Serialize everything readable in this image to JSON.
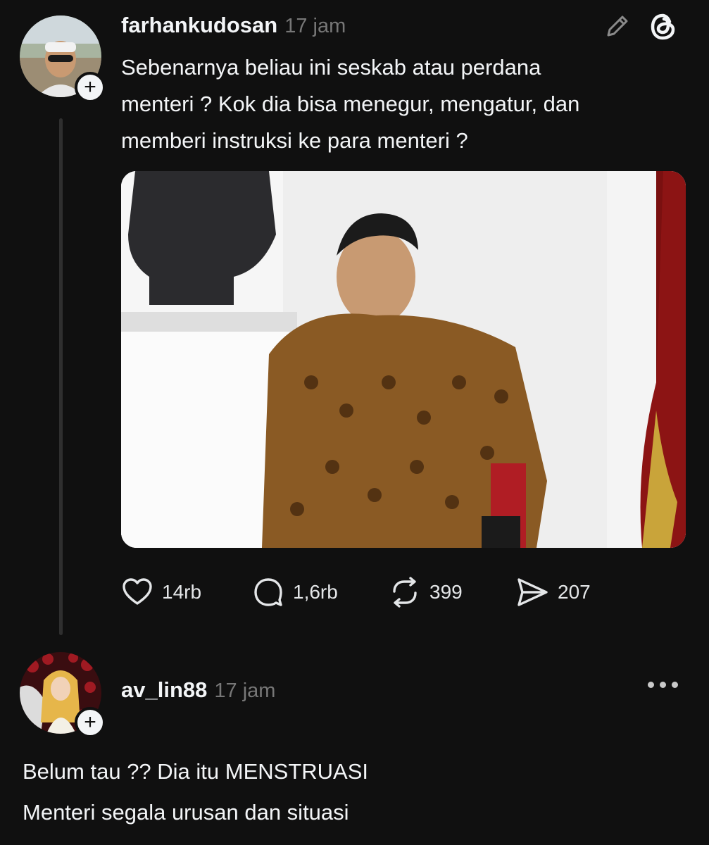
{
  "post": {
    "username": "farhankudosan",
    "time": "17 jam",
    "text": "Sebenarnya beliau ini seskab atau perdana\nmenteri ? Kok dia bisa menegur, mengatur, dan\nmemberi instruksi ke para menteri ?",
    "follow_symbol": "+",
    "icons": {
      "edit": "pencil-icon",
      "app": "threads-logo-icon"
    },
    "actions": {
      "likes": "14rb",
      "replies": "1,6rb",
      "reposts": "399",
      "shares": "207"
    }
  },
  "reply": {
    "username": "av_lin88",
    "time": "17 jam",
    "follow_symbol": "+",
    "line1": "Belum tau ?? Dia itu MENSTRUASI",
    "line2": "Menteri segala urusan dan situasi"
  },
  "colors": {
    "background": "#101010",
    "text": "#f3f5f7",
    "muted": "#777777",
    "thread_line": "#2f2f2f"
  }
}
